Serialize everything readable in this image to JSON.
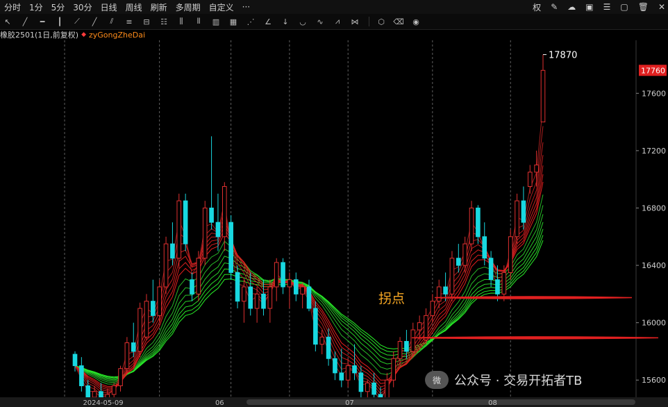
{
  "toolbar": {
    "periods": [
      "分时",
      "1分",
      "5分",
      "30分",
      "日线",
      "周线",
      "刷新",
      "多周期",
      "自定义",
      "···"
    ],
    "right_items": [
      "权",
      "edit-icon",
      "cloud-icon",
      "image-icon",
      "settings-icon",
      "window-icon",
      "delete-icon",
      "close-icon"
    ],
    "right_quan": "权"
  },
  "info": {
    "symbol": "橡胶2501(1日,前复权)",
    "indicator": "zyGongZheDai",
    "dot": "◆"
  },
  "annotation": {
    "text": "拐点"
  },
  "watermark": {
    "text": "公众号 · 交易开拓者TB",
    "logo": "微"
  },
  "colors": {
    "up": "#e03030",
    "down": "#18d8e0",
    "bg": "#000000",
    "ribbon_red": "#e02020",
    "ribbon_green": "#30e030",
    "price_tag": "#e02020"
  },
  "chart_data": {
    "type": "candlestick",
    "title": "",
    "ylim": [
      15480,
      17960
    ],
    "y_ticks": [
      15600,
      16000,
      16400,
      16800,
      17200,
      17600
    ],
    "x_labels": [
      {
        "label": "2024-05-09",
        "date": "2024-05-09"
      },
      {
        "label": "06",
        "date": "2024-06-03"
      },
      {
        "label": "07",
        "date": "2024-07-01"
      },
      {
        "label": "08",
        "date": "2024-08-01"
      }
    ],
    "last_price": 17760,
    "high_label": 17870,
    "support_lines": [
      16175,
      15895
    ],
    "candles": [
      [
        15780,
        15800,
        15660,
        15700
      ],
      [
        15700,
        15760,
        15520,
        15560
      ],
      [
        15560,
        15600,
        15440,
        15480
      ],
      [
        15480,
        15560,
        15420,
        15520
      ],
      [
        15520,
        15580,
        15440,
        15460
      ],
      [
        15460,
        15540,
        15420,
        15500
      ],
      [
        15500,
        15580,
        15460,
        15560
      ],
      [
        15560,
        15700,
        15520,
        15680
      ],
      [
        15680,
        15900,
        15640,
        15860
      ],
      [
        15860,
        16000,
        15760,
        15800
      ],
      [
        15800,
        16140,
        15760,
        16100
      ],
      [
        15900,
        16200,
        15880,
        16150
      ],
      [
        16150,
        16300,
        16000,
        16050
      ],
      [
        16050,
        16300,
        16000,
        16250
      ],
      [
        16250,
        16600,
        16200,
        16550
      ],
      [
        16550,
        16700,
        16400,
        16450
      ],
      [
        16450,
        16900,
        16380,
        16850
      ],
      [
        16850,
        16900,
        16500,
        16550
      ],
      [
        16300,
        16350,
        16150,
        16200
      ],
      [
        16200,
        16500,
        16150,
        16450
      ],
      [
        16450,
        16850,
        16400,
        16800
      ],
      [
        16800,
        17300,
        16650,
        16700
      ],
      [
        16700,
        16900,
        16500,
        16600
      ],
      [
        16600,
        16980,
        16500,
        16950
      ],
      [
        16700,
        16750,
        16300,
        16350
      ],
      [
        16350,
        16400,
        16100,
        16150
      ],
      [
        16150,
        16300,
        16000,
        16250
      ],
      [
        16250,
        16350,
        16050,
        16100
      ],
      [
        16100,
        16250,
        16000,
        16200
      ],
      [
        16200,
        16300,
        16050,
        16100
      ],
      [
        16100,
        16300,
        16000,
        16250
      ],
      [
        16250,
        16450,
        16150,
        16420
      ],
      [
        16420,
        16450,
        16200,
        16250
      ],
      [
        16250,
        16350,
        16100,
        16300
      ],
      [
        16300,
        16350,
        16150,
        16200
      ],
      [
        16200,
        16280,
        16100,
        16250
      ],
      [
        16250,
        16300,
        16080,
        16100
      ],
      [
        16100,
        16150,
        15800,
        15850
      ],
      [
        15850,
        15950,
        15780,
        15900
      ],
      [
        15900,
        15960,
        15700,
        15750
      ],
      [
        15750,
        15800,
        15600,
        15650
      ],
      [
        15650,
        15820,
        15550,
        15600
      ],
      [
        15600,
        15750,
        15550,
        15700
      ],
      [
        15700,
        15850,
        15600,
        15650
      ],
      [
        15650,
        15700,
        15480,
        15520
      ],
      [
        15520,
        15600,
        15420,
        15580
      ],
      [
        15580,
        15650,
        15450,
        15500
      ],
      [
        15500,
        15550,
        15380,
        15420
      ],
      [
        15420,
        15650,
        15400,
        15600
      ],
      [
        15600,
        15800,
        15550,
        15750
      ],
      [
        15750,
        15900,
        15700,
        15870
      ],
      [
        15870,
        15950,
        15750,
        15800
      ],
      [
        15800,
        16000,
        15760,
        15950
      ],
      [
        15950,
        16050,
        15880,
        16000
      ],
      [
        15880,
        16100,
        15850,
        16050
      ],
      [
        16050,
        16200,
        16000,
        16150
      ],
      [
        16150,
        16300,
        16100,
        16250
      ],
      [
        16250,
        16350,
        16150,
        16200
      ],
      [
        16200,
        16500,
        16150,
        16450
      ],
      [
        16450,
        16550,
        16350,
        16400
      ],
      [
        16400,
        16600,
        16350,
        16550
      ],
      [
        16550,
        16850,
        16500,
        16800
      ],
      [
        16800,
        16820,
        16550,
        16600
      ],
      [
        16600,
        16700,
        16400,
        16450
      ],
      [
        16450,
        16500,
        16250,
        16300
      ],
      [
        16300,
        16400,
        16150,
        16200
      ],
      [
        16200,
        16400,
        16150,
        16350
      ],
      [
        16350,
        16650,
        16300,
        16600
      ],
      [
        16600,
        16900,
        16550,
        16850
      ],
      [
        16850,
        16950,
        16650,
        16700
      ],
      [
        16950,
        17100,
        16900,
        17050
      ],
      [
        17050,
        17200,
        16950,
        17100
      ],
      [
        17400,
        17870,
        17400,
        17760
      ]
    ]
  }
}
